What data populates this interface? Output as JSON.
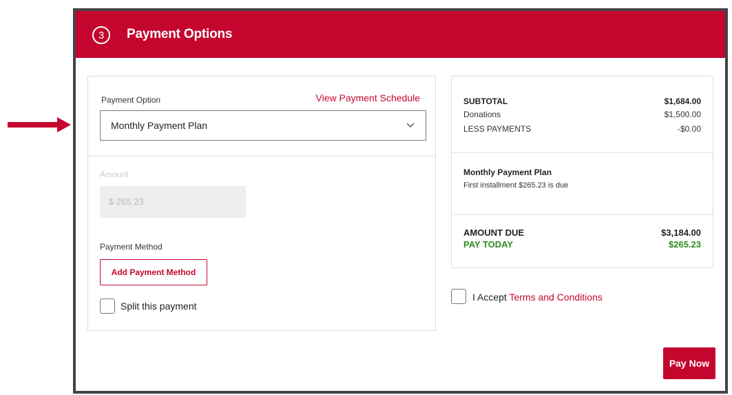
{
  "colors": {
    "brand": "#c4062f",
    "success": "#2e8b23",
    "frame": "#444444"
  },
  "header": {
    "step": "3",
    "title": "Payment Options"
  },
  "payment_option": {
    "label": "Payment Option",
    "view_schedule": "View Payment Schedule",
    "selected": "Monthly Payment Plan"
  },
  "amount": {
    "label": "Amount",
    "value": "$ 265.23"
  },
  "payment_method": {
    "label": "Payment Method",
    "add_button": "Add Payment Method"
  },
  "split": {
    "label": "Split this payment"
  },
  "summary": {
    "subtotal_label": "SUBTOTAL",
    "subtotal_value": "$1,684.00",
    "donations_label": "Donations",
    "donations_value": "$1,500.00",
    "less_label": "LESS PAYMENTS",
    "less_value": "-$0.00",
    "plan_title": "Monthly Payment Plan",
    "plan_desc": "First installment $265.23 is due",
    "amount_due_label": "AMOUNT DUE",
    "amount_due_value": "$3,184.00",
    "pay_today_label": "PAY TODAY",
    "pay_today_value": "$265.23"
  },
  "terms": {
    "prefix": "I Accept",
    "link": "Terms and Conditions"
  },
  "pay_now": "Pay Now"
}
